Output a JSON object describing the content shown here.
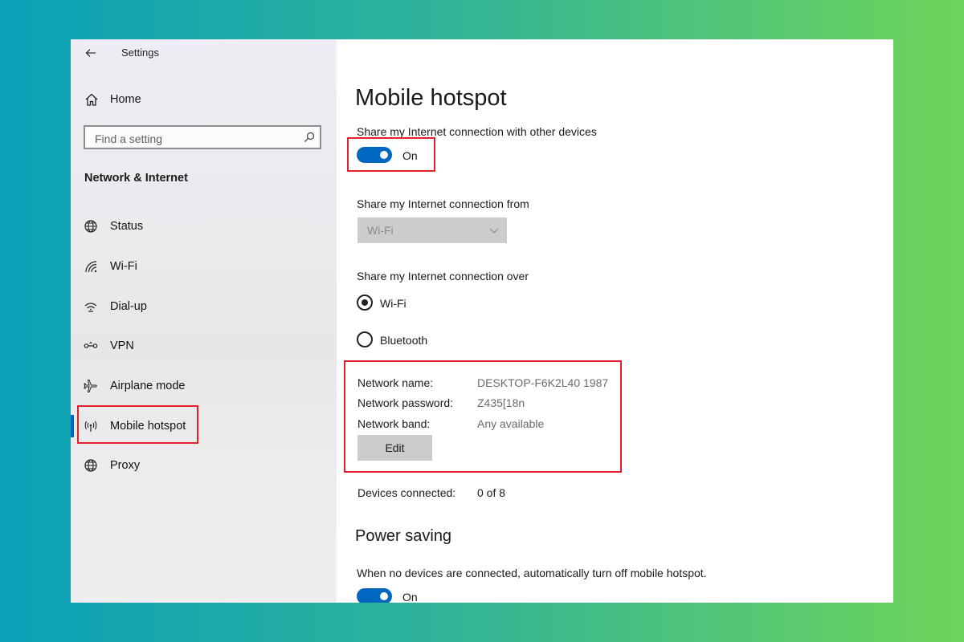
{
  "window": {
    "title": "Settings"
  },
  "sidebar": {
    "home_label": "Home",
    "search_placeholder": "Find a setting",
    "section_heading": "Network & Internet",
    "items": [
      {
        "label": "Status",
        "icon": "globe-icon"
      },
      {
        "label": "Wi-Fi",
        "icon": "wifi-icon"
      },
      {
        "label": "Dial-up",
        "icon": "dial-up-icon"
      },
      {
        "label": "VPN",
        "icon": "vpn-icon"
      },
      {
        "label": "Airplane mode",
        "icon": "airplane-icon"
      },
      {
        "label": "Mobile hotspot",
        "icon": "hotspot-icon",
        "selected": true
      },
      {
        "label": "Proxy",
        "icon": "globe-icon"
      }
    ]
  },
  "main": {
    "title": "Mobile hotspot",
    "share_label": "Share my Internet connection with other devices",
    "share_toggle_state": "On",
    "share_from_label": "Share my Internet connection from",
    "share_from_value": "Wi-Fi",
    "share_over_label": "Share my Internet connection over",
    "share_over_options": [
      {
        "label": "Wi-Fi",
        "checked": true
      },
      {
        "label": "Bluetooth",
        "checked": false
      }
    ],
    "network": {
      "name_key": "Network name:",
      "name_value": "DESKTOP-F6K2L40 1987",
      "password_key": "Network password:",
      "password_value": "Z435[18n",
      "band_key": "Network band:",
      "band_value": "Any available",
      "edit_label": "Edit"
    },
    "devices_key": "Devices connected:",
    "devices_value": "0 of 8",
    "power_saving_title": "Power saving",
    "power_saving_label": "When no devices are connected, automatically turn off mobile hotspot.",
    "power_saving_toggle_state": "On"
  },
  "colors": {
    "accent": "#0067c0",
    "highlight_box": "#e0202a",
    "background_gradient_start": "#0aa0b8",
    "background_gradient_end": "#6fd45a"
  }
}
